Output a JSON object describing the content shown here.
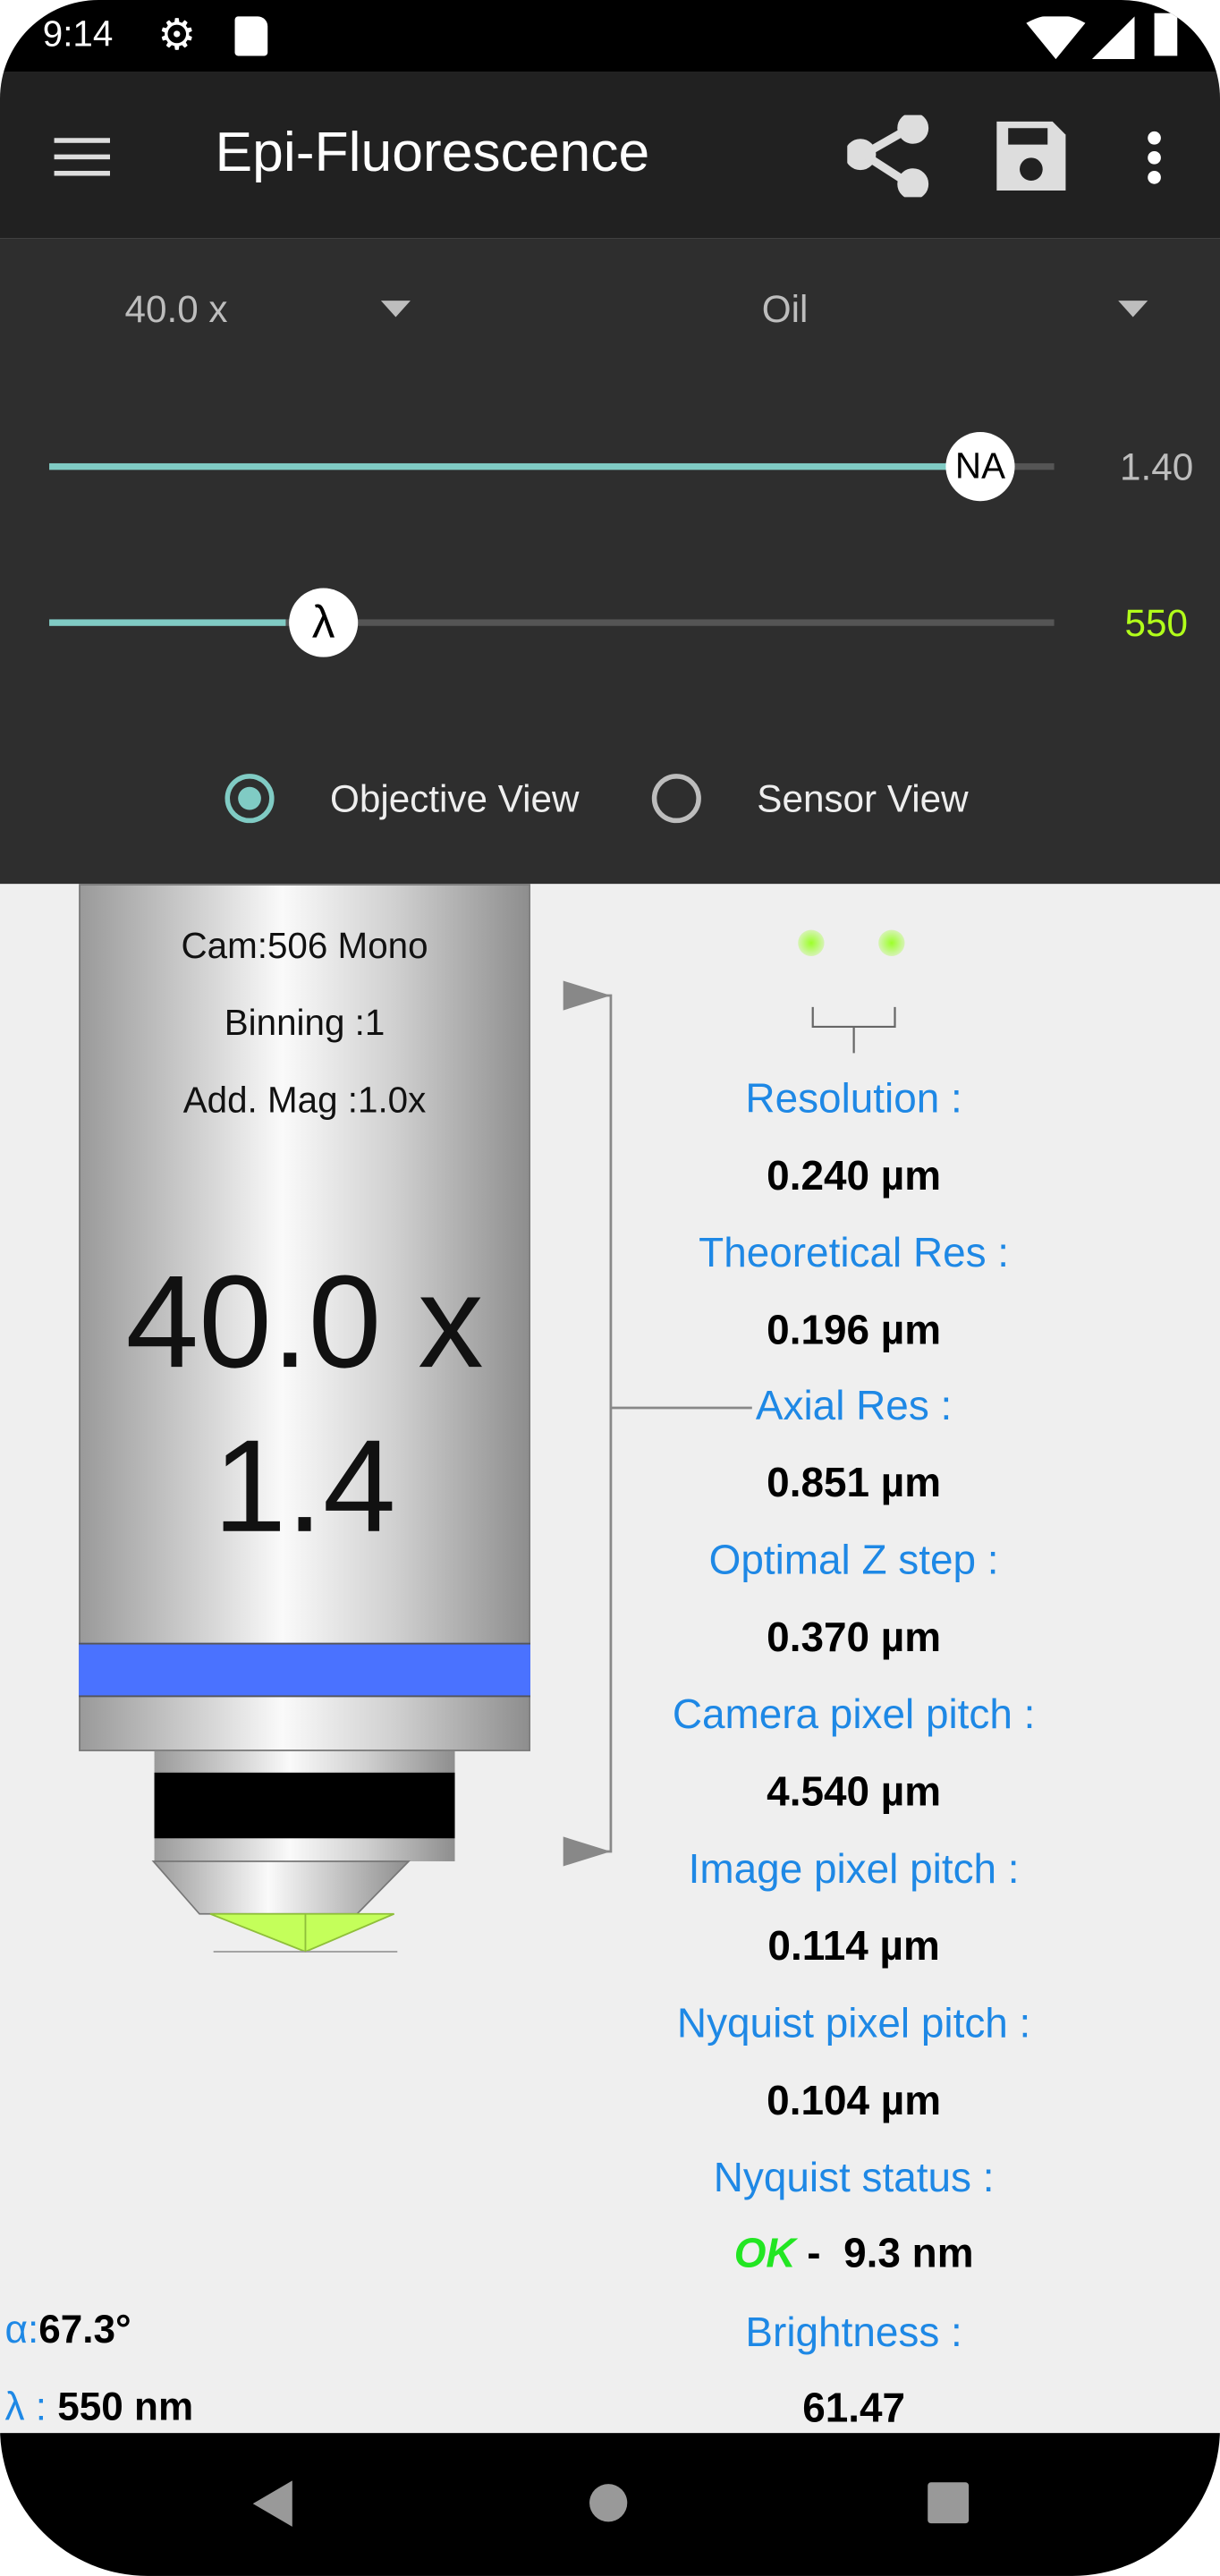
{
  "status_bar": {
    "time": "9:14",
    "icons": [
      "gear-icon",
      "sd-card-icon",
      "wifi-icon",
      "signal-icon",
      "battery-icon"
    ]
  },
  "app_bar": {
    "title": "Epi-Fluorescence",
    "icons": [
      "menu-icon",
      "share-icon",
      "save-icon",
      "more-vert-icon"
    ]
  },
  "controls": {
    "magnification": "40.0 x",
    "immersion": "Oil",
    "na_slider": {
      "thumb_label": "NA",
      "value": "1.40",
      "fraction": 0.93
    },
    "wavelength_slider": {
      "thumb_label": "λ",
      "value": "550",
      "fraction": 0.275
    },
    "views": [
      {
        "label": "Objective View",
        "selected": true
      },
      {
        "label": "Sensor View",
        "selected": false
      }
    ]
  },
  "objective": {
    "camera": "Cam:506 Mono",
    "binning": "Binning :1",
    "add_mag": "Add. Mag :1.0x",
    "magnification": "40.0 x",
    "na": "1.4",
    "band_color": "#4a72ff"
  },
  "results": [
    {
      "label": "Resolution :",
      "value": "0.240 µm"
    },
    {
      "label": "Theoretical Res :",
      "value": "0.196 µm"
    },
    {
      "label": "Axial Res :",
      "value": "0.851 µm"
    },
    {
      "label": "Optimal Z step :",
      "value": "0.370 µm"
    },
    {
      "label": "Camera pixel pitch :",
      "value": "4.540 µm"
    },
    {
      "label": "Image pixel pitch :",
      "value": "0.114 µm"
    },
    {
      "label": "Nyquist pixel pitch :",
      "value": "0.104 µm"
    },
    {
      "label": "Nyquist status :",
      "status": "OK",
      "separator": "-",
      "value": "9.3 nm"
    },
    {
      "label": "Brightness :",
      "value": "61.47"
    }
  ],
  "angles": {
    "alpha_label": "α:",
    "alpha_value": "67.3°",
    "lambda_label": "λ :",
    "lambda_value": "550 nm"
  },
  "colors": {
    "accent": "#80cbc4",
    "label_blue": "#1e88e5",
    "wavelength_green": "#b2ff1a",
    "ok_green": "#22e622"
  }
}
